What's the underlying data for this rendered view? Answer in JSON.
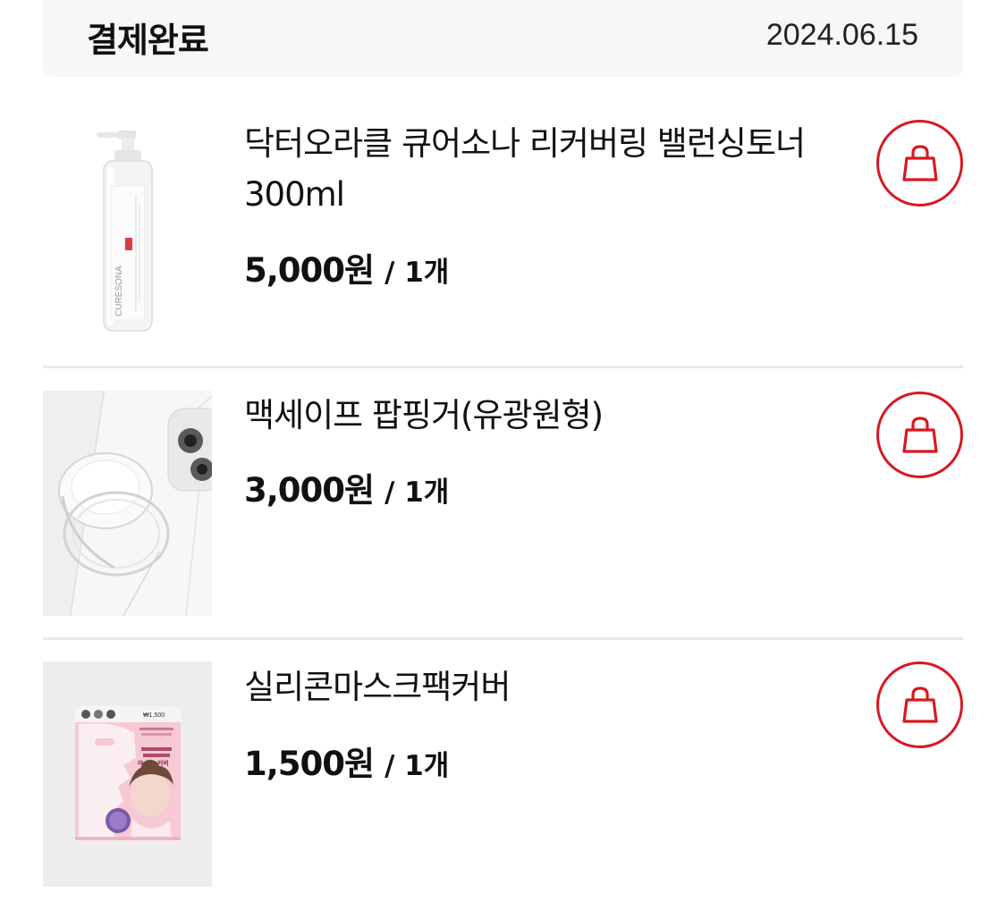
{
  "order": {
    "status": "결제완료",
    "date": "2024.06.15"
  },
  "items": [
    {
      "name": "닥터오라클 큐어소나 리커버링 밸런싱토너 300ml",
      "price": "5,000원",
      "qty": "/ 1개",
      "image": "toner-bottle-image",
      "brand_text": "CURESONA"
    },
    {
      "name": "맥세이프 팝핑거(유광원형)",
      "price": "3,000원",
      "qty": "/ 1개",
      "image": "phone-grip-image"
    },
    {
      "name": "실리콘마스크팩커버",
      "price": "1,500원",
      "qty": "/ 1개",
      "image": "mask-cover-package-image",
      "package_title": "마스크 커버",
      "package_price": "₩1,500"
    }
  ],
  "colors": {
    "accent": "#d71920",
    "header_bg": "#f7f7f7",
    "divider": "#e9e9e9",
    "text": "#111111"
  },
  "icons": {
    "cart": "shopping-bag-icon"
  }
}
